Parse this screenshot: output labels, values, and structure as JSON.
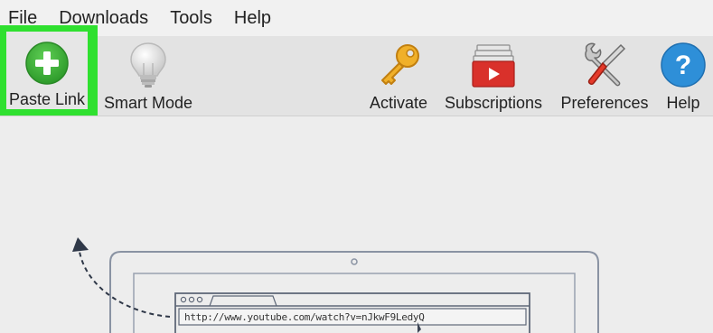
{
  "menu": {
    "items": [
      "File",
      "Downloads",
      "Tools",
      "Help"
    ]
  },
  "toolbar": {
    "paste_link": "Paste Link",
    "smart_mode": "Smart Mode",
    "activate": "Activate",
    "subscriptions": "Subscriptions",
    "preferences": "Preferences",
    "help": "Help"
  },
  "illustration": {
    "url": "http://www.youtube.com/watch?v=nJkwF9LedyQ"
  },
  "colors": {
    "highlight": "#2fe02f",
    "paste_icon": "#3aa63a",
    "help_icon": "#2e8fd8",
    "subscriptions_icon": "#d9312b",
    "key_icon": "#e8a521"
  }
}
